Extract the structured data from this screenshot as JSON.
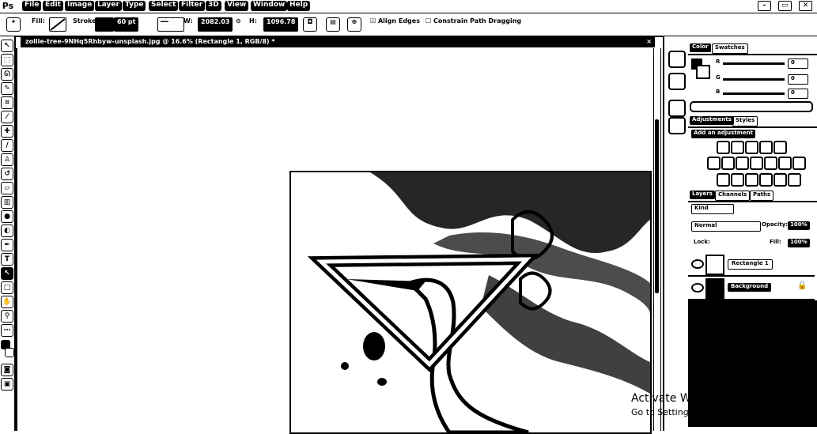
{
  "app": {
    "logo": "Ps"
  },
  "menu": [
    "File",
    "Edit",
    "Image",
    "Layer",
    "Type",
    "Select",
    "Filter",
    "3D",
    "View",
    "Window",
    "Help"
  ],
  "window_controls": [
    "–",
    "▭",
    "✕"
  ],
  "options": {
    "fill_label": "Fill:",
    "stroke_label": "Stroke:",
    "stroke_width": "60 pt",
    "w_label": "W:",
    "w_value": "2082.03",
    "h_label": "H:",
    "h_value": "1096.78",
    "align_edges": "Align Edges",
    "constrain": "Constrain Path Dragging"
  },
  "document": {
    "tab_title": "zollie-tree-9NHq5Rhbyw-unsplash.jpg @ 16.6% (Rectangle 1, RGB/8) *",
    "close": "×"
  },
  "panels": {
    "color_tabs": [
      "Color",
      "Swatches"
    ],
    "color_channels": [
      "R",
      "G",
      "B"
    ],
    "color_values": [
      "0",
      "0",
      "0"
    ],
    "adjust_tabs": [
      "Adjustments",
      "Styles"
    ],
    "add_adjustment": "Add an adjustment",
    "layers_tabs": [
      "Layers",
      "Channels",
      "Paths"
    ],
    "kind_label": "Kind",
    "mode": "Normal",
    "opacity_label": "Opacity:",
    "opacity_value": "100%",
    "lock_label": "Lock:",
    "fill_label": "Fill:",
    "fill_value": "100%",
    "layers": [
      {
        "name": "Rectangle 1"
      },
      {
        "name": "Background"
      }
    ]
  },
  "watermark": {
    "line1": "Activate Windows",
    "line2": "Go to Settings to activate Windows."
  }
}
